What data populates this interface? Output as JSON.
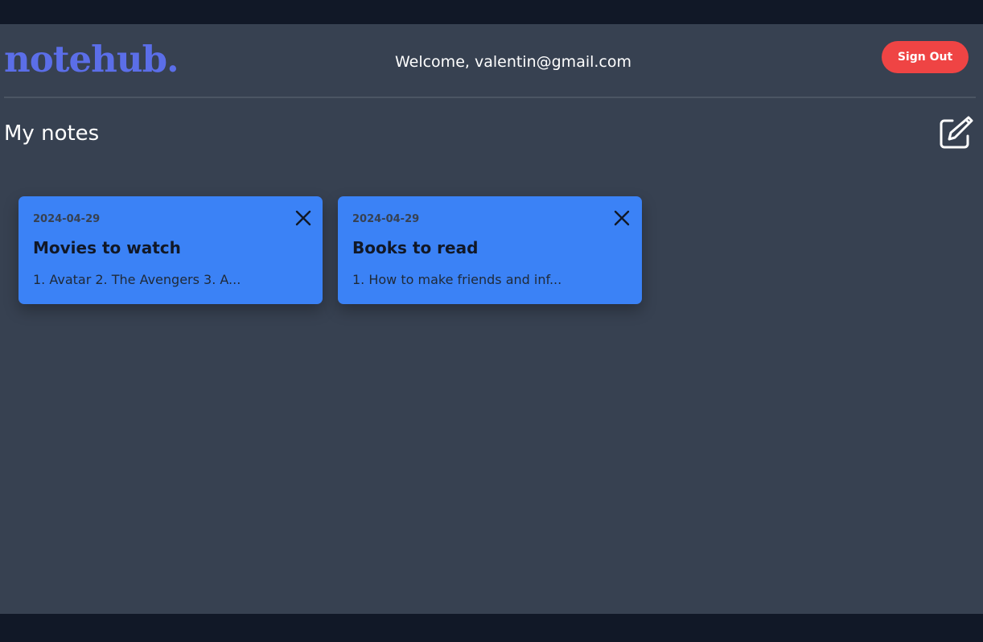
{
  "header": {
    "logo": "notehub.",
    "welcome": "Welcome, valentin@gmail.com",
    "sign_out_label": "Sign Out"
  },
  "main": {
    "title": "My notes",
    "new_note_icon": "edit-note-icon"
  },
  "notes": [
    {
      "date": "2024-04-29",
      "title": "Movies to watch",
      "preview": "1. Avatar 2. The Avengers 3. A..."
    },
    {
      "date": "2024-04-29",
      "title": "Books to read",
      "preview": "1. How to make friends and inf..."
    }
  ],
  "colors": {
    "background": "#374151",
    "frame": "#111827",
    "brand": "#5b6ee8",
    "accent_danger": "#ef4444",
    "card": "#3b82f6"
  }
}
